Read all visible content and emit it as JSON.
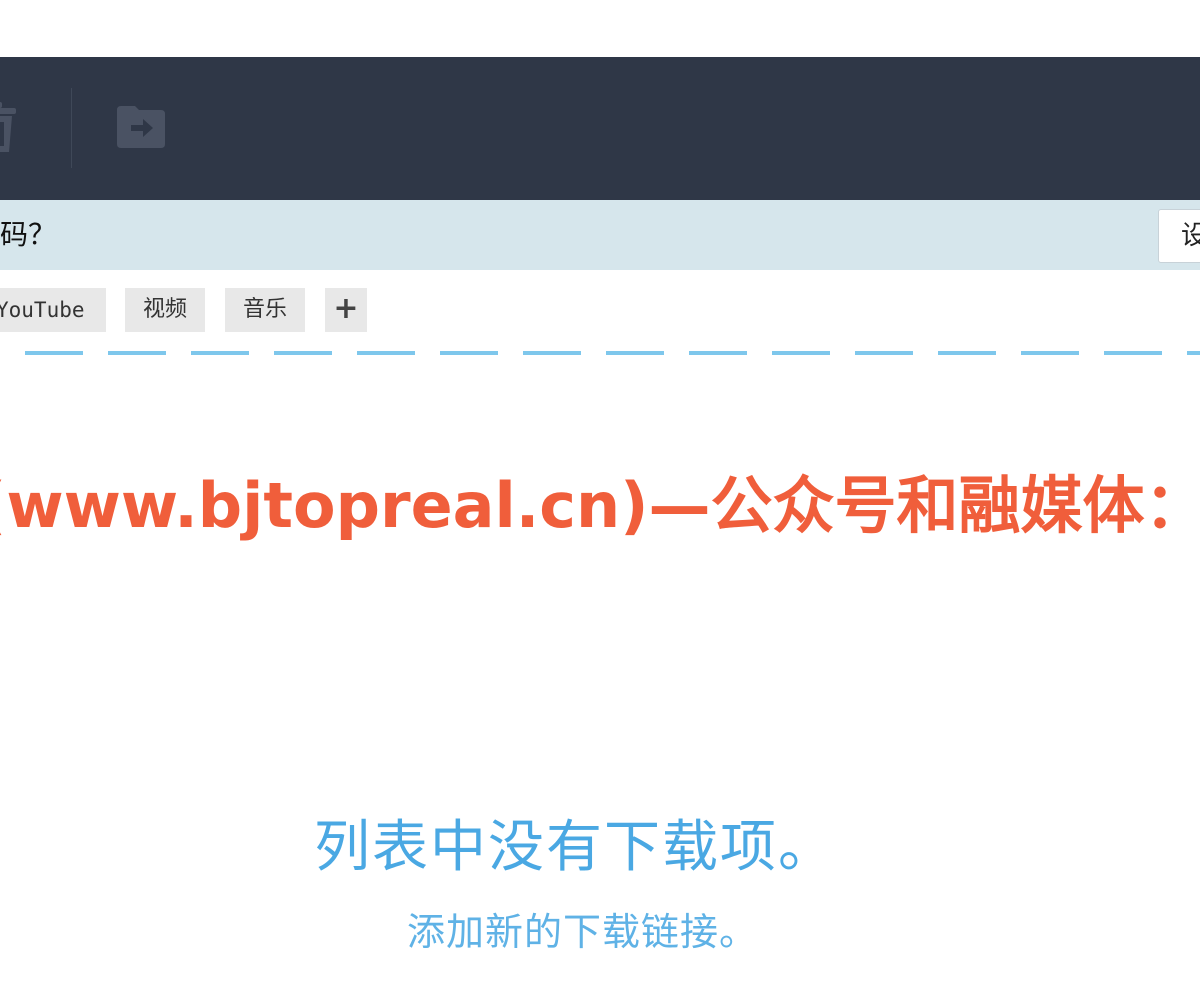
{
  "toolbar": {
    "icons": [
      "trash-icon",
      "move-to-folder-icon"
    ],
    "background": "#2f3747"
  },
  "notice": {
    "text": "码？",
    "button_label": "设"
  },
  "categories": {
    "tabs": [
      {
        "label": "YouTube"
      },
      {
        "label": "视频"
      },
      {
        "label": "音乐"
      }
    ],
    "add_label": "+"
  },
  "watermark": {
    "text": "(www.bjtopreal.cn)—公众号和融媒体：",
    "color": "#f05e3b"
  },
  "empty_state": {
    "title": "列表中没有下载项。",
    "subtitle": "添加新的下载链接。",
    "color": "#4aa8e3"
  }
}
